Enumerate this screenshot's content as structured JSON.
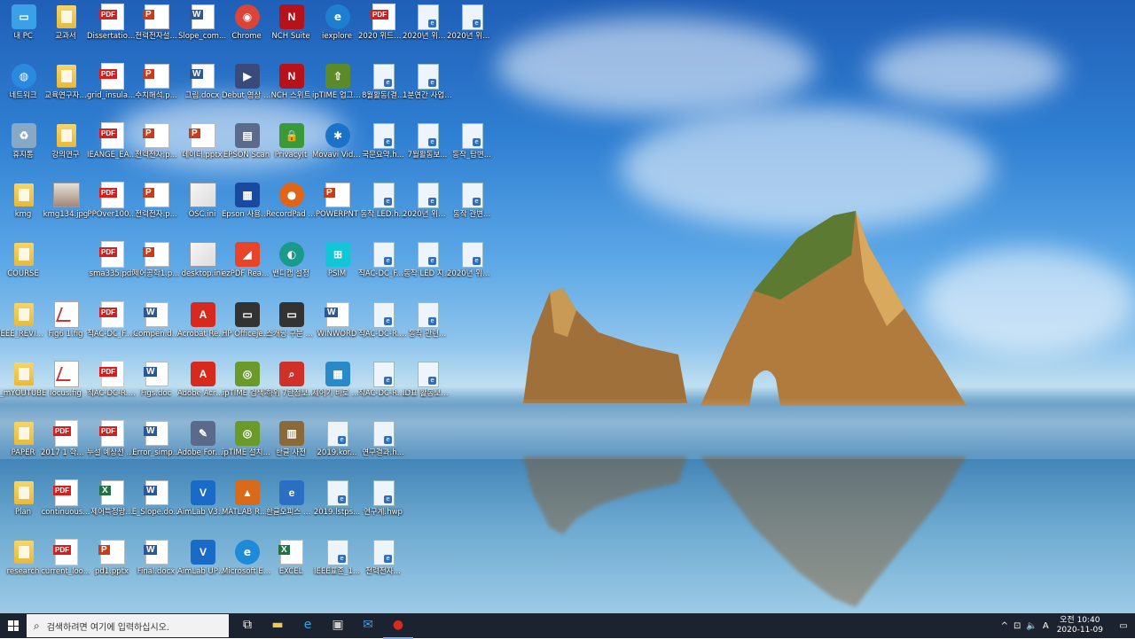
{
  "colors": {
    "taskbar": "#1c2330",
    "pdf": "#d91c1c",
    "word": "#2b579a",
    "excel": "#207245",
    "ppt": "#c43e1c"
  },
  "columns": [
    {
      "col": 0,
      "items": [
        {
          "label": "내 PC",
          "type": "app",
          "icon": "computer-icon"
        },
        {
          "label": "네트워크",
          "type": "app",
          "icon": "network-icon"
        },
        {
          "label": "휴지통",
          "type": "app",
          "icon": "recycle-bin-icon"
        },
        {
          "label": "kmg",
          "type": "folder",
          "icon": "user-folder-icon"
        },
        {
          "label": "COURSE",
          "type": "folder",
          "icon": "folder-icon"
        },
        {
          "label": "IEEE_REVIEW",
          "type": "folder",
          "icon": "folder-icon"
        },
        {
          "label": "_mYOUTUBE",
          "type": "folder",
          "icon": "folder-icon"
        },
        {
          "label": "PAPER",
          "type": "folder",
          "icon": "folder-icon"
        },
        {
          "label": "Plan",
          "type": "folder",
          "icon": "folder-icon"
        },
        {
          "label": "research",
          "type": "folder",
          "icon": "folder-icon"
        }
      ]
    },
    {
      "col": 1,
      "items": [
        {
          "label": "교과서",
          "type": "folder",
          "icon": "folder-icon"
        },
        {
          "label": "교육연구자...",
          "type": "folder",
          "icon": "folder-icon"
        },
        {
          "label": "강의연구",
          "type": "folder",
          "icon": "folder-icon"
        },
        {
          "label": "kmg134.jpg",
          "type": "photo",
          "icon": "photo-icon"
        },
        {
          "label": "",
          "type": "none",
          "icon": ""
        },
        {
          "label": "Fig6 1.fig",
          "type": "fig",
          "icon": "matlab-fig-icon"
        },
        {
          "label": "locus.fig",
          "type": "fig",
          "icon": "matlab-fig-icon"
        },
        {
          "label": "2017 1 학기 강의 자석...",
          "type": "pdf",
          "icon": "pdf-icon"
        },
        {
          "label": "continuous...",
          "type": "pdf",
          "icon": "pdf-icon"
        },
        {
          "label": "current_loo...",
          "type": "pdf",
          "icon": "pdf-icon"
        }
      ]
    },
    {
      "col": 2,
      "items": [
        {
          "label": "Dissertation...",
          "type": "pdf",
          "icon": "pdf-icon"
        },
        {
          "label": "grid_insulat...",
          "type": "pdf",
          "icon": "pdf-icon"
        },
        {
          "label": "IEANGE_EAR...",
          "type": "pdf",
          "icon": "pdf-icon"
        },
        {
          "label": "PPOver100...",
          "type": "pdf",
          "icon": "pdf-icon"
        },
        {
          "label": "sma335.pdf",
          "type": "pdf",
          "icon": "pdf-icon"
        },
        {
          "label": "직AC-DC_F.pdf",
          "type": "pdf",
          "icon": "pdf-icon"
        },
        {
          "label": "직AC-DC-R.pdf",
          "type": "pdf",
          "icon": "pdf-icon"
        },
        {
          "label": "누설 예상선 제작 서식...",
          "type": "pdf",
          "icon": "pdf-icon"
        },
        {
          "label": "제어특정량...",
          "type": "xls",
          "icon": "excel-file-icon"
        },
        {
          "label": "pd1.pptx",
          "type": "ppt",
          "icon": "pptx-file-icon"
        }
      ]
    },
    {
      "col": 3,
      "items": [
        {
          "label": "전력전자설...",
          "type": "ppt",
          "icon": "pptx-file-icon"
        },
        {
          "label": "수치해석.p...",
          "type": "ppt",
          "icon": "pptx-file-icon"
        },
        {
          "label": "전력전자.p...",
          "type": "ppt",
          "icon": "pptx-file-icon"
        },
        {
          "label": "전력전자.p...",
          "type": "ppt",
          "icon": "pptx-file-icon"
        },
        {
          "label": "제어공학1.p...",
          "type": "ppt",
          "icon": "pptx-file-icon"
        },
        {
          "label": "Compen.d...",
          "type": "word",
          "icon": "word-file-icon"
        },
        {
          "label": "Figs.doc",
          "type": "word",
          "icon": "word-file-icon"
        },
        {
          "label": "Error_simp...",
          "type": "word",
          "icon": "word-file-icon"
        },
        {
          "label": "E_Slope.do...",
          "type": "word",
          "icon": "word-file-icon"
        },
        {
          "label": "Final.docx",
          "type": "word",
          "icon": "word-file-icon"
        }
      ]
    },
    {
      "col": 4,
      "items": [
        {
          "label": "Slope_com...",
          "type": "word",
          "icon": "word-file-icon"
        },
        {
          "label": "그림.docx",
          "type": "word",
          "icon": "word-file-icon"
        },
        {
          "label": "데이터.pptx",
          "type": "ppt",
          "icon": "pptx-file-icon"
        },
        {
          "label": "OSC.ini",
          "type": "img",
          "icon": "ini-file-icon"
        },
        {
          "label": "desktop.ini",
          "type": "img",
          "icon": "ini-file-icon"
        },
        {
          "label": "Acrobat Reader DC",
          "type": "app",
          "icon": "acrobat-icon"
        },
        {
          "label": "Adobe Acrobat",
          "type": "app",
          "icon": "acrobat-icon"
        },
        {
          "label": "Adobe FormsCentral",
          "type": "app",
          "icon": "forms-icon"
        },
        {
          "label": "AimLab V3 Internet S...",
          "type": "app",
          "icon": "aimlab-icon"
        },
        {
          "label": "AimLab UPC자기비",
          "type": "app",
          "icon": "aimlab-icon"
        }
      ]
    },
    {
      "col": 5,
      "items": [
        {
          "label": "Chrome",
          "type": "app",
          "icon": "chrome-icon"
        },
        {
          "label": "Debut 영상 캡쳐 프로...",
          "type": "app",
          "icon": "video-capture-icon"
        },
        {
          "label": "EPSON Scan",
          "type": "app",
          "icon": "scanner-icon"
        },
        {
          "label": "Epson 사용설명...",
          "type": "app",
          "icon": "epson-manual-icon"
        },
        {
          "label": "ezPDF Reader K...",
          "type": "app",
          "icon": "ezpdf-icon"
        },
        {
          "label": "HP Officejet Pro 8100",
          "type": "app",
          "icon": "printer-icon"
        },
        {
          "label": "ipTIME 검색기",
          "type": "app",
          "icon": "iptime-icon"
        },
        {
          "label": "ipTIME 설치 도우미",
          "type": "app",
          "icon": "iptime-icon"
        },
        {
          "label": "MATLAB R2014a",
          "type": "app",
          "icon": "matlab-icon"
        },
        {
          "label": "Microsoft Edge",
          "type": "app",
          "icon": "edge-icon"
        }
      ]
    },
    {
      "col": 6,
      "items": [
        {
          "label": "NCH Suite",
          "type": "app",
          "icon": "nch-icon"
        },
        {
          "label": "NCH 스위트",
          "type": "app",
          "icon": "nch-icon"
        },
        {
          "label": "PrivacyIt",
          "type": "app",
          "icon": "privacy-icon"
        },
        {
          "label": "RecordPad Sound R...",
          "type": "app",
          "icon": "recordpad-icon"
        },
        {
          "label": "밴디캠 설정",
          "type": "app",
          "icon": "bandicam-icon"
        },
        {
          "label": "스캐닝 구분 HP Offic...",
          "type": "app",
          "icon": "printer-icon"
        },
        {
          "label": "하위 7탄정보리...",
          "type": "app",
          "icon": "search-app-icon"
        },
        {
          "label": "한글 사전",
          "type": "app",
          "icon": "dictionary-icon"
        },
        {
          "label": "한글오피스 한글 2014",
          "type": "app",
          "icon": "hwp-app-icon"
        },
        {
          "label": "EXCEL",
          "type": "xls",
          "icon": "excel-app-icon"
        }
      ]
    },
    {
      "col": 7,
      "items": [
        {
          "label": "iexplore",
          "type": "app",
          "icon": "ie-icon"
        },
        {
          "label": "ipTIME 업그레이...",
          "type": "app",
          "icon": "iptime-upgrade-icon"
        },
        {
          "label": "Movavi Video Edit...",
          "type": "app",
          "icon": "movavi-icon"
        },
        {
          "label": "POWERPNT",
          "type": "ppt",
          "icon": "powerpoint-app-icon"
        },
        {
          "label": "PSIM",
          "type": "app",
          "icon": "psim-icon"
        },
        {
          "label": "WINWORD",
          "type": "word",
          "icon": "word-app-icon"
        },
        {
          "label": "제어기 바로 가기",
          "type": "app",
          "icon": "shortcut-icon"
        },
        {
          "label": "2019.kor...",
          "type": "hwp",
          "icon": "hwp-file-icon"
        },
        {
          "label": "2019.lstps...",
          "type": "hwp",
          "icon": "hwp-file-icon"
        },
        {
          "label": "IEEE표준_1...",
          "type": "hwp",
          "icon": "hwp-file-icon"
        }
      ]
    },
    {
      "col": 8,
      "items": [
        {
          "label": "2020 위드한자서...",
          "type": "pdf",
          "icon": "pdf-icon"
        },
        {
          "label": "8월활동(결...",
          "type": "hwp",
          "icon": "hwp-file-icon"
        },
        {
          "label": "국문요약.h...",
          "type": "hwp",
          "icon": "hwp-file-icon"
        },
        {
          "label": "동작 LED.h...",
          "type": "hwp",
          "icon": "hwp-file-icon"
        },
        {
          "label": "직AC-DC_F.hwp",
          "type": "hwp",
          "icon": "hwp-file-icon"
        },
        {
          "label": "직AC-DC-R.hwp",
          "type": "hwp",
          "icon": "hwp-file-icon"
        },
        {
          "label": "직AC-DC-R.hwp",
          "type": "hwp",
          "icon": "hwp-file-icon"
        },
        {
          "label": "연구결과.h...",
          "type": "hwp",
          "icon": "hwp-file-icon"
        },
        {
          "label": "연구계.hwp",
          "type": "hwp",
          "icon": "hwp-file-icon"
        },
        {
          "label": "전력전자...",
          "type": "hwp",
          "icon": "hwp-file-icon"
        }
      ]
    },
    {
      "col": 9,
      "items": [
        {
          "label": "2020년 위드한자서...",
          "type": "hwp",
          "icon": "hwp-file-icon"
        },
        {
          "label": "1분연간 사업 입력 ...",
          "type": "hwp",
          "icon": "hwp-file-icon"
        },
        {
          "label": "7월활동보...",
          "type": "hwp",
          "icon": "hwp-file-icon"
        },
        {
          "label": "2020년 위드한자서...",
          "type": "hwp",
          "icon": "hwp-file-icon"
        },
        {
          "label": "동작 LED 지...",
          "type": "hwp",
          "icon": "hwp-file-icon"
        },
        {
          "label": "동작 관련...",
          "type": "hwp",
          "icon": "hwp-file-icon"
        },
        {
          "label": "ID표 활동보고(...",
          "type": "hwp",
          "icon": "hwp-file-icon"
        },
        {
          "label": "",
          "type": "none",
          "icon": ""
        },
        {
          "label": "",
          "type": "none",
          "icon": ""
        },
        {
          "label": "",
          "type": "none",
          "icon": ""
        }
      ]
    },
    {
      "col": 10,
      "items": [
        {
          "label": "2020년 위드한자서...",
          "type": "hwp",
          "icon": "hwp-file-icon"
        },
        {
          "label": "",
          "type": "none",
          "icon": ""
        },
        {
          "label": "동작_탐변...",
          "type": "hwp",
          "icon": "hwp-file-icon"
        },
        {
          "label": "동작 관변...",
          "type": "hwp",
          "icon": "hwp-file-icon"
        },
        {
          "label": "2020년 위드한자서...",
          "type": "hwp",
          "icon": "hwp-file-icon"
        },
        {
          "label": "",
          "type": "none",
          "icon": ""
        },
        {
          "label": "",
          "type": "none",
          "icon": ""
        },
        {
          "label": "",
          "type": "none",
          "icon": ""
        },
        {
          "label": "",
          "type": "none",
          "icon": ""
        },
        {
          "label": "",
          "type": "none",
          "icon": ""
        }
      ]
    }
  ],
  "taskbar": {
    "search_placeholder": "검색하려면 여기에 입력하십시오.",
    "apps": [
      {
        "name": "task-view-button",
        "glyph": "⧉"
      },
      {
        "name": "file-explorer-button",
        "glyph": "▬"
      },
      {
        "name": "edge-button",
        "glyph": "e"
      },
      {
        "name": "store-button",
        "glyph": "▣"
      },
      {
        "name": "mail-button",
        "glyph": "✉"
      },
      {
        "name": "recorder-app-button",
        "glyph": "●"
      }
    ],
    "tray": {
      "chevron": "^",
      "network": "⊡",
      "volume": "🔈",
      "ime": "A",
      "time_line1": "오전 10:40",
      "time_line2": "2020-11-09",
      "notification": "▭"
    }
  }
}
